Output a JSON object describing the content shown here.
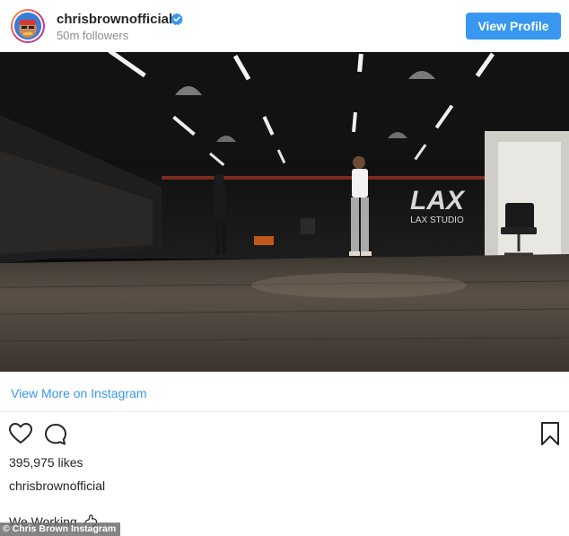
{
  "header": {
    "username": "chrisbrownofficial",
    "followers": "50m followers",
    "view_profile_label": "View Profile"
  },
  "video": {
    "studio_logo_text": "LAX STUDIO"
  },
  "links": {
    "view_more": "View More on Instagram"
  },
  "post": {
    "likes": "395,975 likes",
    "caption_username": "chrisbrownofficial",
    "caption_text": "We Working"
  },
  "watermark": "© Chris Brown Instagram",
  "icons": {
    "avatar": "avatar-image",
    "verified": "verified-badge-icon",
    "like": "heart-icon",
    "comment": "comment-icon",
    "save": "bookmark-icon",
    "caption_emoji": "flexed-biceps-icon"
  },
  "colors": {
    "accent": "#3897f0",
    "text": "#262626",
    "muted": "#8e8e8e"
  }
}
